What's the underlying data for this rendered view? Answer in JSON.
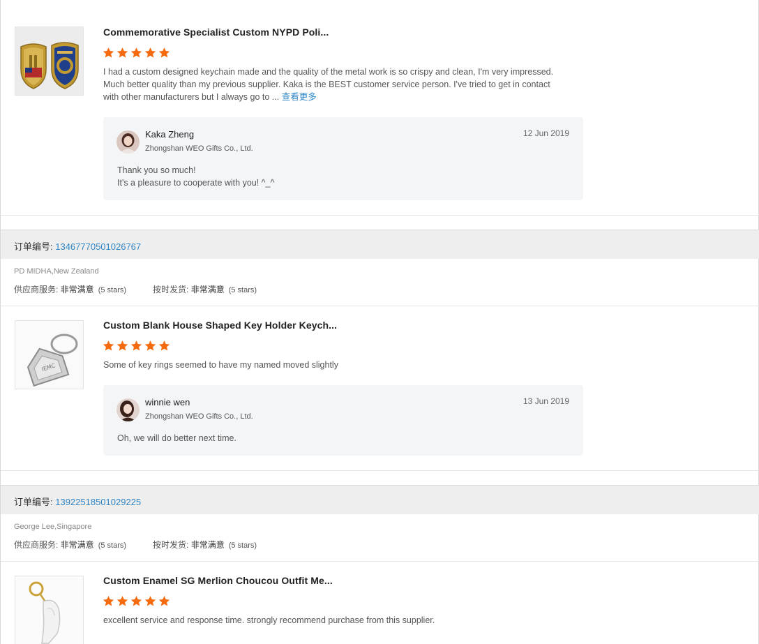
{
  "reviews": [
    {
      "product_title": "Commemorative Specialist Custom NYPD Poli...",
      "review_text": "I had a custom designed keychain made and the quality of the metal work is so crispy and clean, I'm very impressed. Much better quality than my previous supplier. Kaka is the BEST customer service person. I've tried to get in contact with other manufacturers but I always go to ... ",
      "more_label": "查看更多",
      "reply": {
        "name": "Kaka Zheng",
        "company": "Zhongshan WEO Gifts Co., Ltd.",
        "date": "12 Jun 2019",
        "line1": "Thank you so much!",
        "line2": "It's a pleasure to cooperate with you! ^_^"
      }
    },
    {
      "order_label": "订单编号: ",
      "order_number": "13467770501026767",
      "buyer": "PD MIDHA,New Zealand",
      "supplier_service_label": "供应商服务: ",
      "supplier_service_value": "非常满意",
      "supplier_service_count": "(5 stars)",
      "shipment_label": "按时发货: ",
      "shipment_value": "非常满意",
      "shipment_count": "(5 stars)",
      "product_title": "Custom Blank House Shaped Key Holder Keych...",
      "review_text": "Some of key rings seemed to have my named moved slightly",
      "reply": {
        "name": "winnie wen",
        "company": "Zhongshan WEO Gifts Co., Ltd.",
        "date": "13 Jun 2019",
        "line1": "Oh, we will do better next time."
      }
    },
    {
      "order_label": "订单编号: ",
      "order_number": "13922518501029225",
      "buyer": "George Lee,Singapore",
      "supplier_service_label": "供应商服务: ",
      "supplier_service_value": "非常满意",
      "supplier_service_count": "(5 stars)",
      "shipment_label": "按时发货: ",
      "shipment_value": "非常满意",
      "shipment_count": "(5 stars)",
      "product_title": "Custom Enamel SG Merlion Choucou Outfit Me...",
      "review_text": "excellent service and response time. strongly recommend purchase from this supplier."
    }
  ],
  "ratings": [
    5,
    5,
    5
  ],
  "colors": {
    "star": "#f66b0e",
    "link": "#2e86c7",
    "reply_bg": "#f3f5f7",
    "order_bar_bg": "#eeeeee"
  }
}
